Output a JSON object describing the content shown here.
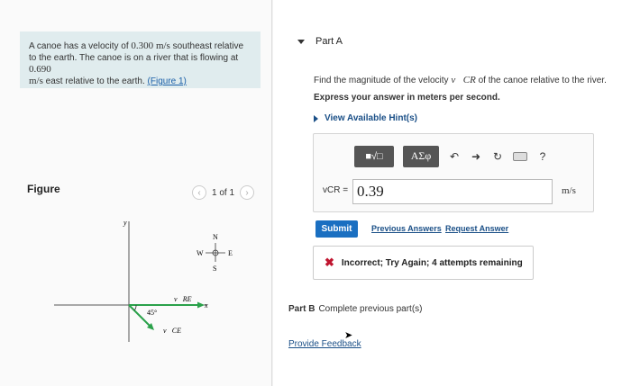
{
  "problem": {
    "line1": "A canoe has a velocity of ",
    "line1_value": "0.300",
    "line1_unit": "m/s",
    "line1_rest": " southeast relative to the earth. The canoe is on a river that is flowing at ",
    "line2_value": "0.690",
    "line2_unit": "m/s",
    "line2_rest": " east relative to the earth. ",
    "figure_link": "(Figure 1)"
  },
  "figure": {
    "label": "Figure",
    "pager_text": "1 of 1",
    "prev_icon": "chevron-left-icon",
    "next_icon": "chevron-right-icon",
    "compass": {
      "n": "N",
      "s": "S",
      "e": "E",
      "w": "W"
    },
    "axis_x": "x",
    "axis_y": "y",
    "angle": "45°",
    "vec_re": "v⃗RE",
    "vec_ce": "v⃗CE",
    "colors": {
      "vector": "#2aa14a",
      "axis": "#444"
    }
  },
  "partA": {
    "title": "Part A",
    "question_pre": "Find the magnitude of the velocity ",
    "question_var": "v⃗CR",
    "question_post": " of the canoe relative to the river.",
    "express": "Express your answer in meters per second.",
    "hint": "View Available Hint(s)",
    "toolbar": {
      "template_icon": "template-sqrt-icon",
      "greek": "ΑΣφ",
      "undo_icon": "undo-icon",
      "redo_icon": "redo-icon",
      "reset_icon": "reset-icon",
      "keyboard_icon": "keyboard-icon",
      "help": "?"
    },
    "var_label": "vCR =",
    "answer_value": "0.39",
    "unit": "m/s",
    "submit": "Submit",
    "previous_answers": "Previous Answers",
    "request_answer": "Request Answer",
    "feedback": "Incorrect; Try Again; 4 attempts remaining"
  },
  "partB": {
    "title": "Part B",
    "text": "Complete previous part(s)"
  },
  "provide_feedback": "Provide Feedback"
}
